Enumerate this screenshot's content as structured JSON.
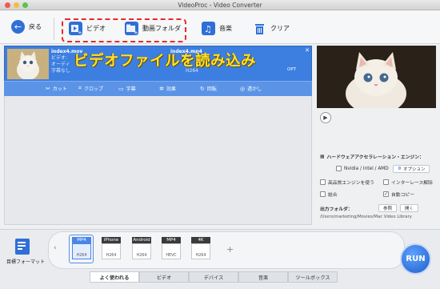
{
  "window": {
    "title": "VideoProc - Video Converter"
  },
  "toolbar": {
    "back_label": "戻る",
    "video_label": "ビデオ",
    "folder_label": "動画フォルダ",
    "music_label": "音楽",
    "clear_label": "クリア"
  },
  "overlay": {
    "text": "ビデオファイルを読み込み"
  },
  "file": {
    "name_left": "index4.mov",
    "name_right": "index4.mp4",
    "video_label": "ビデオ:",
    "audio_label": "オーディ",
    "subtitle_label": "字幕なし",
    "codec_h264": "H264",
    "opt_label": "OPT"
  },
  "edit": {
    "cut": "カット",
    "crop": "クロップ",
    "subtitle": "字幕",
    "effect": "効果",
    "rotate": "回転",
    "watermark": "透かし"
  },
  "right": {
    "hw_title": "ハードウェアアクセラレーション・エンジン：",
    "nvidia": "Nvidia / Intel / AMD",
    "option_btn": "オプション",
    "hq_engine": "高品質エンジンを使う",
    "deinterlace": "インターレース解除",
    "merge": "結合",
    "auto_copy": "自動コピー",
    "out_folder_label": "出力フォルダ：",
    "browse": "参照",
    "open": "開く",
    "out_path": "/Users/marketing/Movies/Mac Video Library"
  },
  "bottom": {
    "target_format_label": "目標フォーマット",
    "formats": [
      {
        "top": "MP4",
        "codec": "H264"
      },
      {
        "top": "iPhone",
        "codec": "H264"
      },
      {
        "top": "Android",
        "codec": "H264"
      },
      {
        "top": "MP4",
        "codec": "HEVC"
      },
      {
        "top": "4K",
        "codec": "H264"
      }
    ],
    "tabs": [
      "よく使われる",
      "ビデオ",
      "デバイス",
      "音楽",
      "ツールボックス"
    ],
    "run_label": "RUN"
  },
  "colors": {
    "accent": "#2f6fd6",
    "dashed_highlight": "#e42b2b",
    "overlay_text": "#ffe22e"
  }
}
